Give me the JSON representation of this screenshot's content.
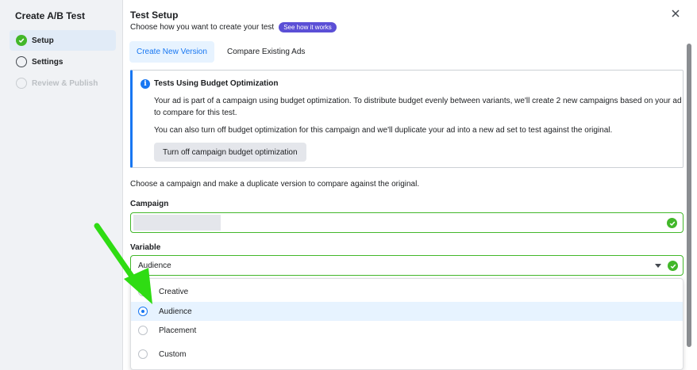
{
  "sidebar": {
    "title": "Create A/B Test",
    "steps": [
      {
        "label": "Setup",
        "state": "done"
      },
      {
        "label": "Settings",
        "state": "pending"
      },
      {
        "label": "Review & Publish",
        "state": "disabled"
      }
    ]
  },
  "header": {
    "title": "Test Setup",
    "subtitle": "Choose how you want to create your test",
    "help_pill": "See how it works",
    "close_icon": "close-icon"
  },
  "tabs": [
    {
      "label": "Create New Version",
      "active": true
    },
    {
      "label": "Compare Existing Ads",
      "active": false
    }
  ],
  "info": {
    "icon": "info-icon",
    "title": "Tests Using Budget Optimization",
    "paragraph1": "Your ad is part of a campaign using budget optimization. To distribute budget evenly between variants, we'll create 2 new campaigns based on your ad to compare for this test.",
    "paragraph2": "You can also turn off budget optimization for this campaign and we'll duplicate your ad into a new ad set to test against the original.",
    "button": "Turn off campaign budget optimization"
  },
  "choose_text": "Choose a campaign and make a duplicate version to compare against the original.",
  "campaign": {
    "label": "Campaign",
    "value": ""
  },
  "variable": {
    "label": "Variable",
    "value": "Audience",
    "options": [
      {
        "label": "Creative",
        "selected": false
      },
      {
        "label": "Audience",
        "selected": true
      },
      {
        "label": "Placement",
        "selected": false
      },
      {
        "label": "Custom",
        "selected": false
      }
    ]
  },
  "colors": {
    "accent": "#1877f2",
    "success": "#42b72a",
    "pill": "#5b4fd6",
    "annotation_arrow": "#2fdc13"
  }
}
